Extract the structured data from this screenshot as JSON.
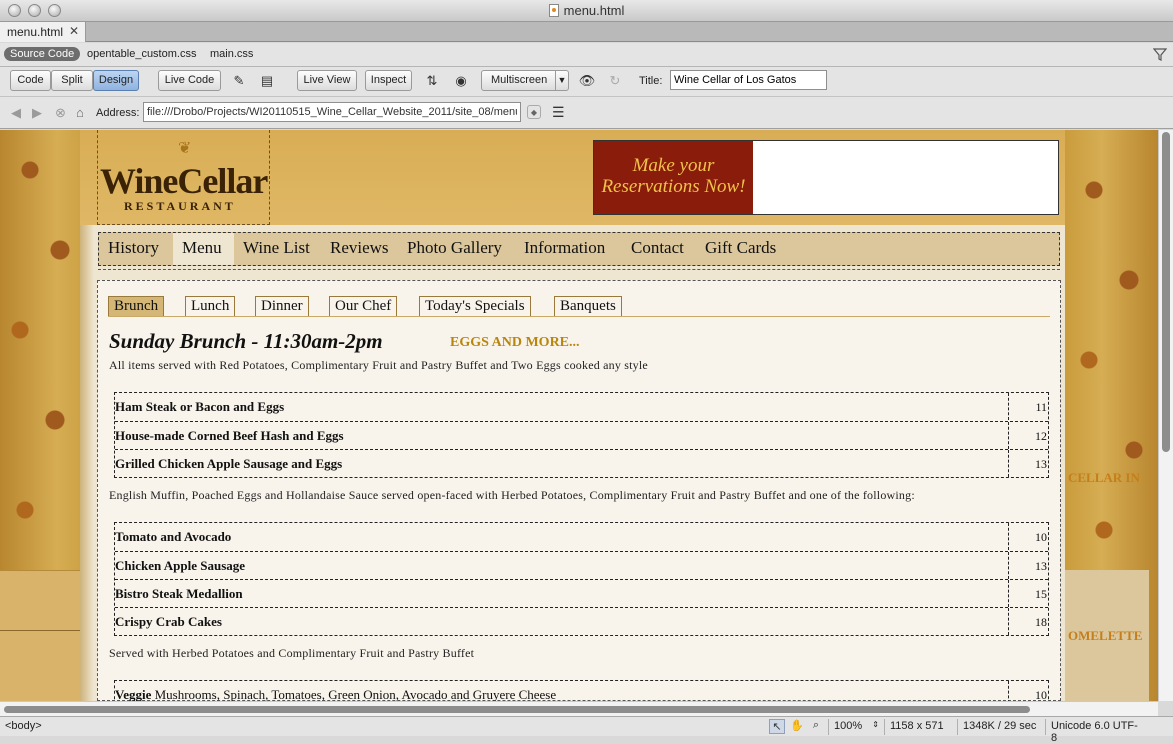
{
  "window": {
    "title": "menu.html"
  },
  "tabs": {
    "document_tab": "menu.html",
    "close_glyph": "✕"
  },
  "related_files": [
    "Source Code",
    "opentable_custom.css",
    "main.css"
  ],
  "toolbar": {
    "code": "Code",
    "split": "Split",
    "design": "Design",
    "live_code": "Live Code",
    "live_view": "Live View",
    "inspect": "Inspect",
    "multiscreen": "Multiscreen",
    "title_label": "Title:",
    "title_value": "Wine Cellar of Los Gatos"
  },
  "address": {
    "label": "Address:",
    "value": "file:///Drobo/Projects/WI20110515_Wine_Cellar_Website_2011/site_08/menu.html"
  },
  "site": {
    "logo_main": "WineCellar",
    "logo_sub": "RESTAURANT",
    "promo_line1": "Make your",
    "promo_line2": "Reservations Now!",
    "nav": [
      "History",
      "Menu",
      "Wine List",
      "Reviews",
      "Photo Gallery",
      "Information",
      "Contact",
      "Gift Cards"
    ],
    "subtabs": [
      "Brunch",
      "Lunch",
      "Dinner",
      "Our Chef",
      "Today's Specials",
      "Banquets"
    ],
    "heading": "Sunday Brunch - 11:30am-2pm",
    "heading_sub": "EGGS AND MORE...",
    "intro1": "All items served with Red Potatoes, Complimentary Fruit and Pastry Buffet and Two Eggs cooked any style",
    "table1": [
      {
        "name": "Ham Steak or Bacon and Eggs",
        "price": "11"
      },
      {
        "name": "House-made Corned Beef Hash and Eggs",
        "price": "12"
      },
      {
        "name": "Grilled Chicken Apple Sausage and Eggs",
        "price": "13"
      }
    ],
    "intro2": "English Muffin, Poached Eggs and Hollandaise Sauce served open-faced with Herbed Potatoes, Complimentary Fruit and Pastry Buffet and one of the following:",
    "table2": [
      {
        "name": "Tomato and Avocado",
        "price": "10"
      },
      {
        "name": "Chicken Apple Sausage",
        "price": "13"
      },
      {
        "name": "Bistro Steak Medallion",
        "price": "15"
      },
      {
        "name": "Crispy Crab Cakes",
        "price": "18"
      }
    ],
    "intro3": "Served with Herbed Potatoes and Complimentary Fruit and Pastry Buffet",
    "table3": [
      {
        "name": "Veggie",
        "desc": " Mushrooms, Spinach, Tomatoes, Green Onion, Avocado and Gruyere Cheese",
        "price": "10"
      }
    ],
    "side_text1": "CELLAR IN",
    "side_text2": "OMELETTE"
  },
  "status": {
    "tag": "<body>",
    "zoom": "100%",
    "dimensions": "1158 x 571",
    "filesize": "1348K / 29 sec",
    "encoding": "Unicode 6.0 UTF-8"
  }
}
